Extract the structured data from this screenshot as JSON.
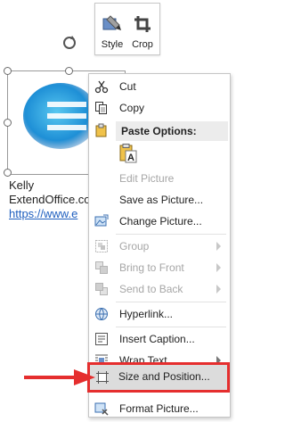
{
  "mini_toolbar": {
    "style_label": "Style",
    "crop_label": "Crop"
  },
  "document": {
    "line1": "Kelly",
    "line2": "ExtendOffice.co",
    "link": "https://www.e"
  },
  "context_menu": {
    "cut": "Cut",
    "copy": "Copy",
    "paste_options": "Paste Options:",
    "edit_picture": "Edit Picture",
    "save_as_picture": "Save as Picture...",
    "change_picture": "Change Picture...",
    "group": "Group",
    "bring_to_front": "Bring to Front",
    "send_to_back": "Send to Back",
    "hyperlink": "Hyperlink...",
    "insert_caption": "Insert Caption...",
    "wrap_text": "Wrap Text",
    "size_and_position": "Size and Position...",
    "format_picture": "Format Picture..."
  },
  "colors": {
    "highlight_outline": "#e52e2e",
    "link": "#1f5fbf",
    "disabled_text": "#a6a6a6"
  }
}
